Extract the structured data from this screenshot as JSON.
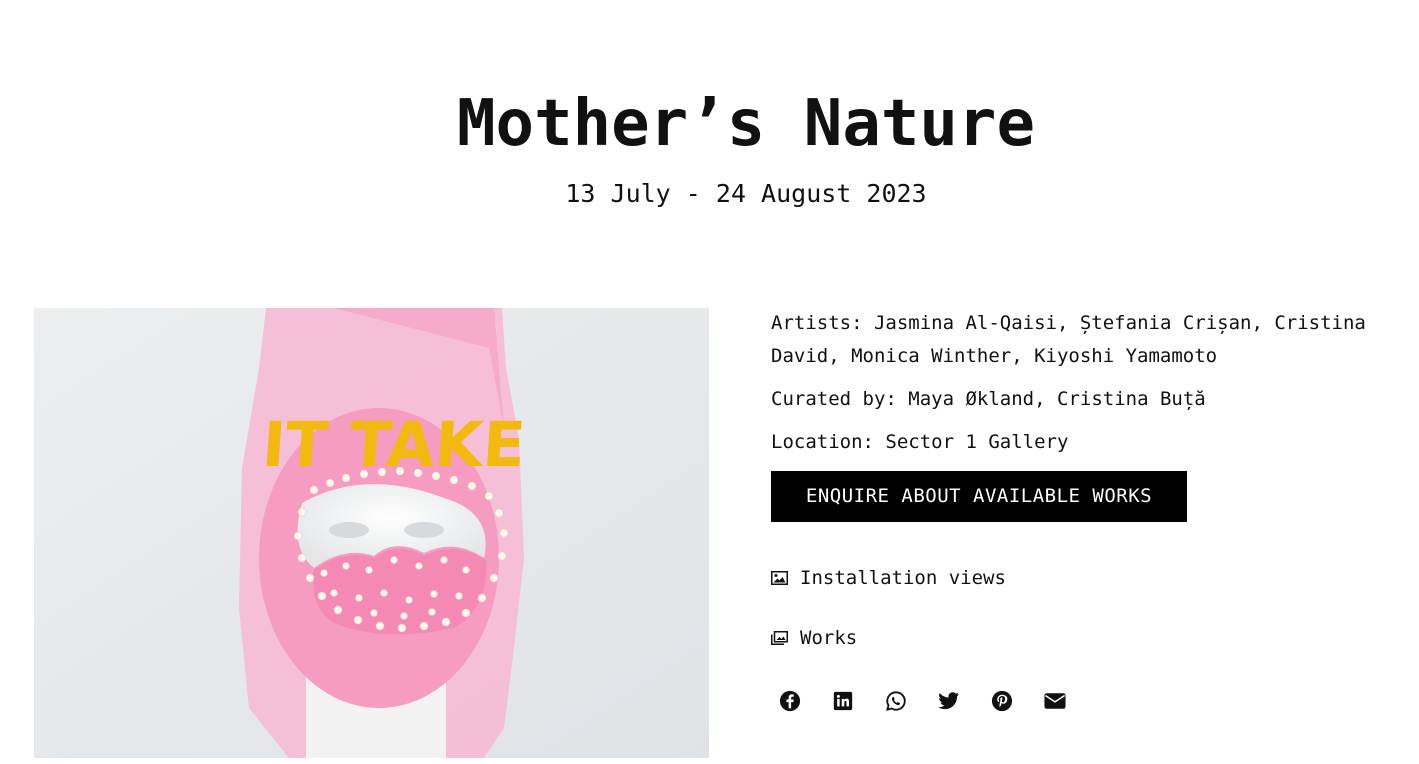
{
  "exhibition": {
    "title": "Mother’s Nature",
    "dates": "13 July - 24 August 2023"
  },
  "artwork": {
    "text_on_mask": "IT TAKE"
  },
  "details": {
    "artists_label": "Artists:",
    "artists": "Jasmina Al-Qaisi, Ștefania Crișan, Cristina David, Monica Winther, Kiyoshi Yamamoto",
    "curated_label": "Curated by:",
    "curators": "Maya Økland, Cristina Buță",
    "location_label": "Location:",
    "location": "Sector 1 Gallery"
  },
  "actions": {
    "enquire_label": "ENQUIRE ABOUT AVAILABLE WORKS",
    "installation_views_label": "Installation views",
    "works_label": "Works"
  },
  "social": [
    "facebook-icon",
    "linkedin-icon",
    "whatsapp-icon",
    "twitter-icon",
    "pinterest-icon",
    "email-icon"
  ],
  "colors": {
    "text": "#111111",
    "button_bg": "#000000",
    "button_text": "#ffffff",
    "mask_pink": "#f7a6c8",
    "mask_yellow": "#f2b90f"
  }
}
